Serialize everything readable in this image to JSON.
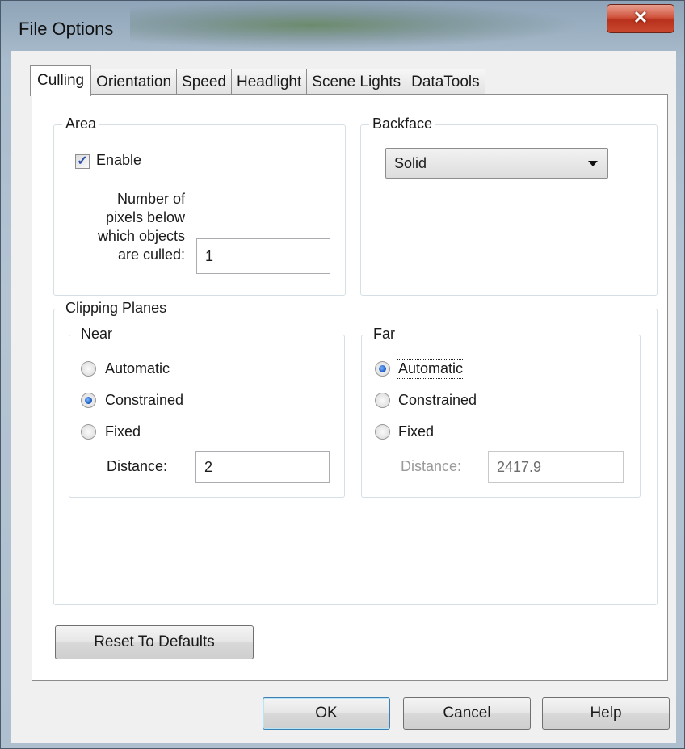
{
  "window": {
    "title": "File Options",
    "close_symbol": "✕"
  },
  "tabs": [
    {
      "label": "Culling",
      "active": true
    },
    {
      "label": "Orientation",
      "active": false
    },
    {
      "label": "Speed",
      "active": false
    },
    {
      "label": "Headlight",
      "active": false
    },
    {
      "label": "Scene Lights",
      "active": false
    },
    {
      "label": "DataTools",
      "active": false
    }
  ],
  "area": {
    "legend": "Area",
    "enable_label": "Enable",
    "enable_checked": true,
    "pixels_label_lines": [
      "Number of",
      "pixels below",
      "which objects",
      "are culled:"
    ],
    "pixels_value": "1"
  },
  "backface": {
    "legend": "Backface",
    "selected": "Solid"
  },
  "clipping": {
    "legend": "Clipping Planes",
    "near": {
      "legend": "Near",
      "options": [
        "Automatic",
        "Constrained",
        "Fixed"
      ],
      "selected": "Constrained",
      "distance_label": "Distance:",
      "distance_value": "2"
    },
    "far": {
      "legend": "Far",
      "options": [
        "Automatic",
        "Constrained",
        "Fixed"
      ],
      "selected": "Automatic",
      "distance_label": "Distance:",
      "distance_value": "2417.9"
    }
  },
  "reset_label": "Reset To Defaults",
  "footer": {
    "ok": "OK",
    "cancel": "Cancel",
    "help": "Help"
  },
  "colors": {
    "accent": "#1f5fc8",
    "close_button": "#c9482f"
  }
}
